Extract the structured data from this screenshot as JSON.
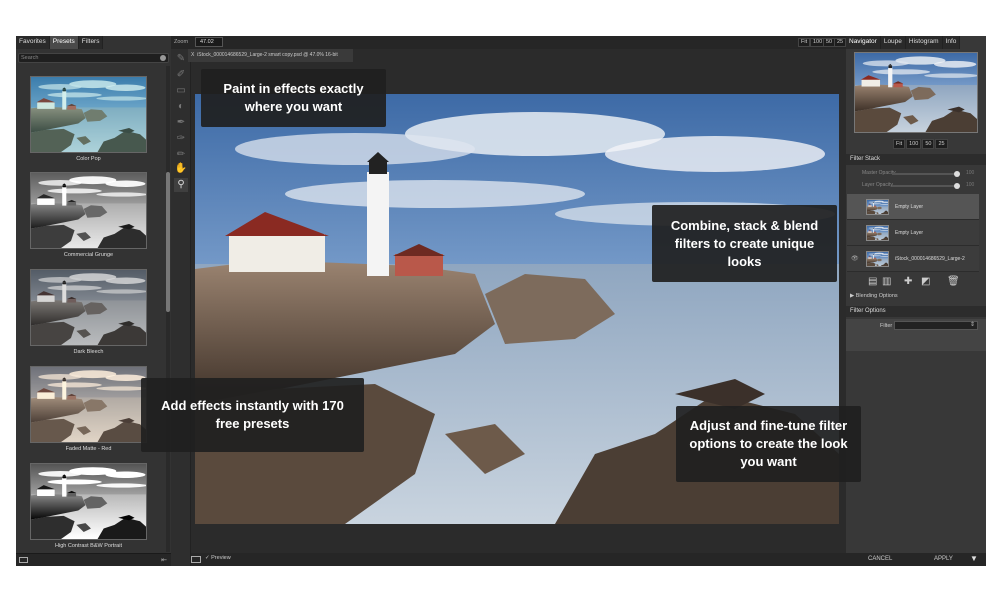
{
  "left_panel": {
    "tabs": [
      "Favorites",
      "Presets",
      "Filters"
    ],
    "search_placeholder": "Search",
    "presets": [
      "Color Pop",
      "Commercial Grunge",
      "Dark Bleech",
      "Faded Matte - Red",
      "High Contrast B&W Portrait"
    ]
  },
  "toolbar": {
    "zoom_label": "Zoom",
    "zoom_value": "47.02",
    "zoom_buttons": [
      "Fit",
      "100",
      "50",
      "25"
    ]
  },
  "document": {
    "tab_close": "X",
    "tab_title": "iStock_000014686529_Large-2 smart copy.psd @ 47.0% 16-bit"
  },
  "bottom_bar": {
    "preview_label": "Preview"
  },
  "right_panel": {
    "tabs": [
      "Navigator",
      "Loupe",
      "Histogram",
      "Info"
    ],
    "nav_zoom_buttons": [
      "Fit",
      "100",
      "50",
      "25"
    ],
    "filter_stack_title": "Filter Stack",
    "master_opacity_label": "Master Opacity",
    "master_opacity_value": "100",
    "layer_opacity_label": "Layer Opacity",
    "layer_opacity_value": "100",
    "layers": [
      "Empty Layer",
      "Empty Layer",
      "iStock_000014686529_Large-2"
    ],
    "blending_options": "Blending Options",
    "filter_options_title": "Filter Options",
    "filter_label": "Filter",
    "cancel_label": "CANCEL",
    "apply_label": "APPLY"
  },
  "callouts": {
    "paint": "Paint in effects exactly where you want",
    "combine": "Combine, stack & blend filters to create unique looks",
    "presets": "Add effects instantly with 170 free presets",
    "adjust": "Adjust and fine-tune filter options to create the look you want"
  }
}
